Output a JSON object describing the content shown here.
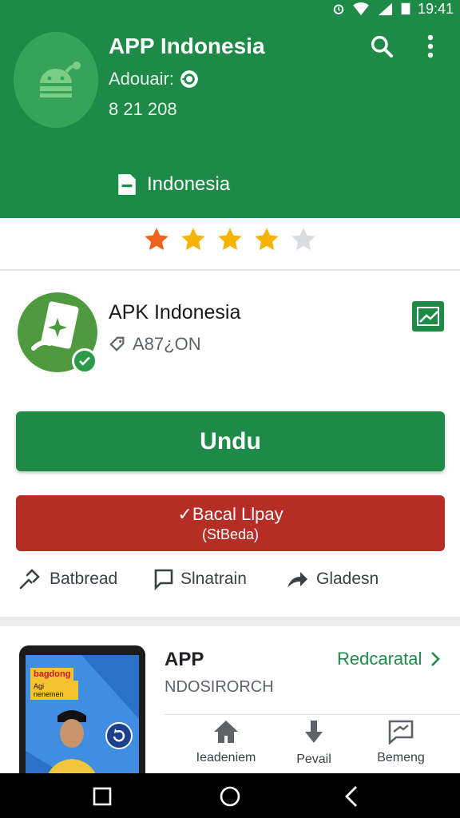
{
  "status_bar": {
    "time": "19:41"
  },
  "header": {
    "app_title": "APP Indonesia",
    "developer_label": "Adouair:",
    "date": "8 21 208",
    "region": "Indonesia",
    "bg_color": "#1e8a47"
  },
  "rating": {
    "stars_filled": 4,
    "stars_total": 5
  },
  "app_card": {
    "title": "APK Indonesia",
    "code": "A87¿ON"
  },
  "buttons": {
    "primary_label": "Undu",
    "secondary_line1": "✓Bacal Llpay",
    "secondary_line2": "(StBeda)"
  },
  "actions": [
    {
      "label": "Batbread",
      "icon": "link-icon"
    },
    {
      "label": "Slnatrain",
      "icon": "comment-icon"
    },
    {
      "label": "Gladesn",
      "icon": "share-icon"
    }
  ],
  "publisher": {
    "title": "APP",
    "name": "NDOSIRORCH",
    "link_label": "Redcaratal",
    "banner_top": "bagdong",
    "banner_sub": "Agi nenemen"
  },
  "publisher_icons": [
    {
      "label": "Ieadeniem",
      "icon": "home-icon"
    },
    {
      "label": "Pevail",
      "icon": "download-icon"
    },
    {
      "label": "Bemeng",
      "icon": "message-icon"
    }
  ],
  "colors": {
    "green": "#1e8a47",
    "red": "#b52d24",
    "star_filled": "#f5b400",
    "star_first": "#f0641e",
    "star_empty": "#dadce0"
  }
}
